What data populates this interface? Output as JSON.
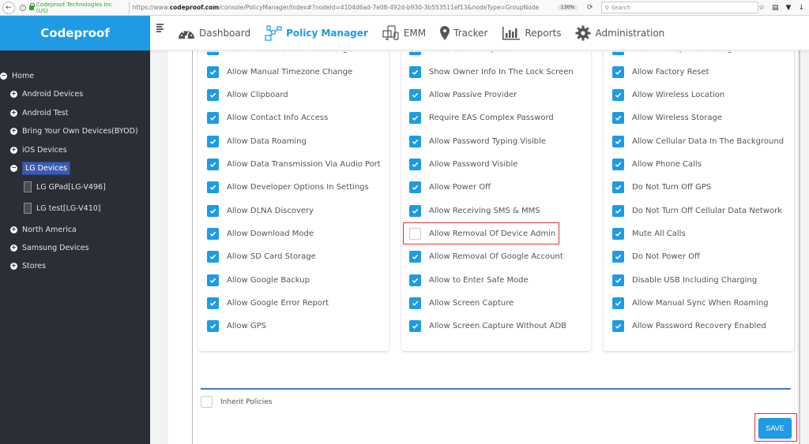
{
  "browser": {
    "identity": "Codeproof Technologies Inc (US)",
    "url_prefix": "https://www.",
    "url_domain": "codeproof.com",
    "url_rest": "/console/PolicyManager/Index#?nodeId=4104d6ad-7e08-492d-b930-3b553511ef13&nodeType=GroupNode",
    "zoom": "130%",
    "search_placeholder": "Search"
  },
  "brand": {
    "name": "Codeproof"
  },
  "nav": {
    "items": [
      {
        "label": "Dashboard",
        "icon": "dashboard-gauge-icon",
        "active": false
      },
      {
        "label": "Policy Manager",
        "icon": "policy-network-icon",
        "active": true
      },
      {
        "label": "EMM",
        "icon": "devices-icon",
        "active": false
      },
      {
        "label": "Tracker",
        "icon": "map-pin-icon",
        "active": false
      },
      {
        "label": "Reports",
        "icon": "bar-chart-icon",
        "active": false
      },
      {
        "label": "Administration",
        "icon": "gear-icon",
        "active": false
      }
    ]
  },
  "sidebar": {
    "tree": [
      {
        "label": "Home",
        "type": "collapse",
        "level": 0
      },
      {
        "label": "Android Devices",
        "type": "expand",
        "level": 1
      },
      {
        "label": "Android Test",
        "type": "expand",
        "level": 1
      },
      {
        "label": "Bring Your Own Devices(BYOD)",
        "type": "expand",
        "level": 1
      },
      {
        "label": "iOS Devices",
        "type": "expand",
        "level": 1
      },
      {
        "label": "LG Devices",
        "type": "collapse",
        "level": 1,
        "selected": true
      },
      {
        "label": "LG GPad[LG-V496]",
        "type": "device",
        "level": 2
      },
      {
        "label": "LG test[LG-V410]",
        "type": "device",
        "level": 2
      },
      {
        "label": "North America",
        "type": "expand",
        "level": 1
      },
      {
        "label": "Samsung Devices",
        "type": "expand",
        "level": 1
      },
      {
        "label": "Stores",
        "type": "expand",
        "level": 1
      }
    ]
  },
  "policies": {
    "columns": [
      [
        {
          "label": "Allow Manual DateTime Change",
          "checked": true
        },
        {
          "label": "Allow Manual Timezone Change",
          "checked": true
        },
        {
          "label": "Allow Clipboard",
          "checked": true
        },
        {
          "label": "Allow Contact Info Access",
          "checked": true
        },
        {
          "label": "Allow Data Roaming",
          "checked": true
        },
        {
          "label": "Allow Data Transmission Via Audio Port",
          "checked": true
        },
        {
          "label": "Allow Developer Options In Settings",
          "checked": true
        },
        {
          "label": "Allow DLNA Discovery",
          "checked": true
        },
        {
          "label": "Allow Download Mode",
          "checked": true
        },
        {
          "label": "Allow SD Card Storage",
          "checked": true
        },
        {
          "label": "Allow Google Backup",
          "checked": true
        },
        {
          "label": "Allow Google Error Report",
          "checked": true
        },
        {
          "label": "Allow GPS",
          "checked": true
        }
      ],
      [
        {
          "label": "Allow OS OTA Update",
          "checked": true
        },
        {
          "label": "Show Owner Info In The Lock Screen",
          "checked": true
        },
        {
          "label": "Allow Passive Provider",
          "checked": true
        },
        {
          "label": "Require EAS Complex Password",
          "checked": true
        },
        {
          "label": "Allow Password Typing Visible",
          "checked": true
        },
        {
          "label": "Allow Password Visible",
          "checked": true
        },
        {
          "label": "Allow Power Off",
          "checked": true
        },
        {
          "label": "Allow Receiving SMS & MMS",
          "checked": true
        },
        {
          "label": "Allow Removal Of Device Admin",
          "checked": false
        },
        {
          "label": "Allow Removal Of Google Account",
          "checked": true
        },
        {
          "label": "Allow to Enter Safe Mode",
          "checked": true
        },
        {
          "label": "Allow Screen Capture",
          "checked": true
        },
        {
          "label": "Allow Screen Capture Without ADB",
          "checked": true
        }
      ],
      [
        {
          "label": "Allow VPN Split Tunneling",
          "checked": true
        },
        {
          "label": "Allow Factory Reset",
          "checked": true
        },
        {
          "label": "Allow Wireless Location",
          "checked": true
        },
        {
          "label": "Allow Wireless Storage",
          "checked": true
        },
        {
          "label": "Allow Cellular Data In The Background",
          "checked": true
        },
        {
          "label": "Allow Phone Calls",
          "checked": true
        },
        {
          "label": "Do Not Turn Off GPS",
          "checked": true
        },
        {
          "label": "Do Not Turn Off Cellular Data Network",
          "checked": true
        },
        {
          "label": "Mute All Calls",
          "checked": true
        },
        {
          "label": "Do Not Power Off",
          "checked": true
        },
        {
          "label": "Disable USB Including Charging",
          "checked": true
        },
        {
          "label": "Allow Manual Sync When Roaming",
          "checked": true
        },
        {
          "label": "Allow Password Recovery Enabled",
          "checked": true
        }
      ]
    ]
  },
  "footer": {
    "inherit_label": "Inherit Policies",
    "inherit_checked": false,
    "save_label": "SAVE"
  },
  "colors": {
    "brand": "#1e9be4",
    "sidebar": "#2b2f35",
    "selected_node": "#3b5cae",
    "highlight": "#e0343a"
  }
}
